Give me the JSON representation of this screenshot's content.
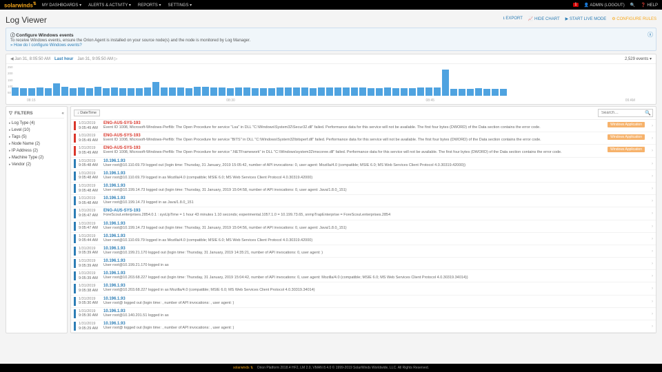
{
  "header": {
    "brand": "solarwinds",
    "nav": [
      "MY DASHBOARDS ▾",
      "ALERTS & ACTIVITY ▾",
      "REPORTS ▾",
      "SETTINGS ▾"
    ],
    "notif": "1",
    "user": "👤 ADMIN (LOGOUT)",
    "help": "❓ HELP"
  },
  "page": {
    "title": "Log Viewer",
    "actions": {
      "export": "⭳ EXPORT",
      "hide": "📈 HIDE CHART",
      "live": "▶ START LIVE MODE",
      "rules": "⚙ CONFIGURE RULES"
    }
  },
  "info": {
    "title": "ⓘ Configure Windows events",
    "body": "To receive Windows events, ensure the Orion Agent is installed on your source node(s) and the node is monitored by Log Manager.",
    "link": "» How do I configure Windows events?"
  },
  "time": {
    "from": "◀ Jan 31, 8:05:50 AM",
    "label": "Last hour",
    "to": "Jan 31, 9:05:50 AM ▷",
    "count": "2,529 events ▾"
  },
  "chart_data": {
    "type": "bar",
    "ylabels": [
      "250",
      "200",
      "150",
      "100",
      "50"
    ],
    "xlabels": [
      "08:15",
      "08:30",
      "08:45",
      "09 AM"
    ],
    "values": [
      70,
      65,
      65,
      70,
      65,
      110,
      80,
      65,
      70,
      65,
      75,
      65,
      70,
      65,
      65,
      65,
      70,
      120,
      70,
      70,
      70,
      65,
      80,
      75,
      70,
      70,
      65,
      70,
      70,
      65,
      65,
      65,
      70,
      70,
      70,
      70,
      65,
      70,
      70,
      70,
      70,
      70,
      70,
      65,
      65,
      70,
      65,
      65,
      65,
      70,
      70,
      70,
      225,
      60,
      62,
      62,
      66,
      62,
      62,
      62
    ]
  },
  "filters": {
    "title": "FILTERS",
    "items": [
      "Log Type (4)",
      "Level (10)",
      "Tags (5)",
      "Node Name (2)",
      "IP Address (2)",
      "Machine Type (2)",
      "Vendor (2)"
    ]
  },
  "logs": {
    "sort": "↓ DateTime",
    "searchPh": "Search…",
    "badge": "Windows Application",
    "rows": [
      {
        "stripe": "red",
        "d": "1/31/2019",
        "t": "9:05:49 AM",
        "node": "ENG-AUS-SYS-193",
        "cls": "err",
        "msg": "Event ID 1008, Microsoft-Windows-Perflib: The Open Procedure for service \"Lsa\" in DLL \"C:\\Windows\\System32\\Secur32.dll\" failed. Performance data for this service will not be available. The first four bytes (DWORD) of the Data section contains the error code.",
        "badge": true
      },
      {
        "stripe": "red",
        "d": "1/31/2019",
        "t": "9:05:49 AM",
        "node": "ENG-AUS-SYS-193",
        "cls": "err",
        "msg": "Event ID 1008, Microsoft-Windows-Perflib: The Open Procedure for service \"BITS\" in DLL \"C:\\Windows\\System32\\bitsperf.dll\" failed. Performance data for this service will not be available. The first four bytes (DWORD) of the Data section contains the error code.",
        "badge": true
      },
      {
        "stripe": "red",
        "d": "1/31/2019",
        "t": "9:05:49 AM",
        "node": "ENG-AUS-SYS-193",
        "cls": "err",
        "msg": "Event ID 1008, Microsoft-Windows-Perflib: The Open Procedure for service \".NETFramework\" in DLL \"C:\\Windows\\system32\\mscoree.dll\" failed. Performance data for this service will not be available. The first four bytes (DWORD) of the Data section contains the error code.",
        "badge": true
      },
      {
        "stripe": "blue",
        "d": "1/31/2019",
        "t": "9:05:48 AM",
        "node": "10.196.1.93",
        "cls": "ok",
        "msg": "User root@10.110.69.79 logged out (login time: Thursday, 31 January, 2019 15:05:42, number of API invocations: 0, user agent: Mozilla/4.0 (compatible; MSIE 6.0; MS Web Services Client Protocol 4.0.30319.42000))"
      },
      {
        "stripe": "blue",
        "d": "1/31/2019",
        "t": "9:05:48 AM",
        "node": "10.196.1.93",
        "cls": "ok",
        "msg": "User root@10.110.69.79 logged in as Mozilla/4.0 (compatible; MSIE 6.0; MS Web Services Client Protocol 4.0.30319.42000)"
      },
      {
        "stripe": "blue",
        "d": "1/31/2019",
        "t": "9:05:48 AM",
        "node": "10.196.1.93",
        "cls": "ok",
        "msg": "User root@10.199.14.73 logged out (login time: Thursday, 31 January, 2019 15:04:58, number of API invocations: 0, user agent: Java/1.8.0_151)"
      },
      {
        "stripe": "blue",
        "d": "1/31/2019",
        "t": "9:05:48 AM",
        "node": "10.196.1.93",
        "cls": "ok",
        "msg": "User root@10.199.14.73 logged in as Java/1.8.0_151"
      },
      {
        "stripe": "blue",
        "d": "1/31/2019",
        "t": "9:05:47 AM",
        "node": "ENG-AUS-SYS-193",
        "cls": "ok",
        "msg": "ForeScout.enterprises.2854.0.1 : sysUpTime = 1 hour 43 minutes 1.10 seconds; experimental.1057.1.0 = 10.199.73.65, snmpTrapEnterprise = ForeScout.enterprises.2854"
      },
      {
        "stripe": "blue",
        "d": "1/31/2019",
        "t": "9:05:47 AM",
        "node": "10.196.1.93",
        "cls": "ok",
        "msg": "User root@10.199.14.73 logged out (login time: Thursday, 31 January, 2019 15:04:56, number of API invocations: 0, user agent: Java/1.8.0_151)"
      },
      {
        "stripe": "blue",
        "d": "1/31/2019",
        "t": "9:05:44 AM",
        "node": "10.196.1.93",
        "cls": "ok",
        "msg": "User root@10.110.69.79 logged in as Mozilla/4.0 (compatible; MSIE 6.0; MS Web Services Client Protocol 4.0.30319.42000)"
      },
      {
        "stripe": "blue",
        "d": "1/31/2019",
        "t": "9:05:39 AM",
        "node": "10.196.1.93",
        "cls": "ok",
        "msg": "User root@10.199.21.170 logged out (login time: Thursday, 31 January, 2019 14:35:21, number of API invocations: 0, user agent: )"
      },
      {
        "stripe": "blue",
        "d": "1/31/2019",
        "t": "9:05:39 AM",
        "node": "10.196.1.93",
        "cls": "ok",
        "msg": "User root@10.199.21.170 logged in as"
      },
      {
        "stripe": "blue",
        "d": "1/31/2019",
        "t": "9:05:39 AM",
        "node": "10.196.1.93",
        "cls": "ok",
        "msg": "User root@10.203.68.227 logged out (login time: Thursday, 31 January, 2019 15:04:42, number of API invocations: 0, user agent: Mozilla/4.0 (compatible; MSIE 6.0; MS Web Services Client Protocol 4.0.30319.34014))"
      },
      {
        "stripe": "blue",
        "d": "1/31/2019",
        "t": "9:05:38 AM",
        "node": "10.196.1.93",
        "cls": "ok",
        "msg": "User root@10.203.68.227 logged in as Mozilla/4.0 (compatible; MSIE 6.0; MS Web Services Client Protocol 4.0.30319.34014)"
      },
      {
        "stripe": "blue",
        "d": "1/31/2019",
        "t": "9:05:30 AM",
        "node": "10.196.1.93",
        "cls": "ok",
        "msg": "User root@ logged out (login time: , number of API invocations: , user agent: )"
      },
      {
        "stripe": "blue",
        "d": "1/31/2019",
        "t": "9:05:30 AM",
        "node": "10.196.1.93",
        "cls": "ok",
        "msg": "User root@10.140.201.51 logged in as"
      },
      {
        "stripe": "blue",
        "d": "1/31/2019",
        "t": "9:05:29 AM",
        "node": "10.196.1.93",
        "cls": "ok",
        "msg": "User root@ logged out (login time: , number of API invocations: , user agent: )"
      }
    ]
  },
  "footer": {
    "brand": "solarwinds ⇅",
    "text": "Orion Platform 2018.4 HF2, LM 2.0, VMAN 8.4.0 © 1999-2019 SolarWinds Worldwide, LLC. All Rights Reserved."
  }
}
